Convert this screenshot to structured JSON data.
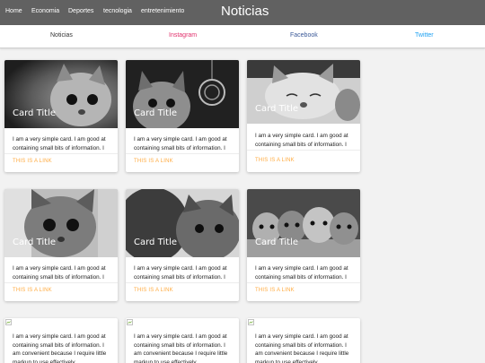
{
  "nav": {
    "brand": "Noticias",
    "links": [
      "Home",
      "Economia",
      "Deportes",
      "tecnologia",
      "entretenimiento"
    ]
  },
  "tabs": [
    {
      "label": "Noticias",
      "color": "#333333"
    },
    {
      "label": "Instagram",
      "color": "#e1306c"
    },
    {
      "label": "Facebook",
      "color": "#3b5998"
    },
    {
      "label": "Twitter",
      "color": "#1da1f2"
    }
  ],
  "image_cards": [
    {
      "title": "Card Title",
      "text": "I am a very simple card. I am good at containing small bits of information. I am convenient because I require little markup to use effectively.",
      "link": "THIS IS A LINK",
      "image": "kitten-photo"
    },
    {
      "title": "Card Title",
      "text": "I am a very simple card. I am good at containing small bits of information. I am convenient because I require little markup to use effectively.",
      "link": "THIS IS A LINK",
      "image": "kitten-with-ball-photo"
    },
    {
      "title": "Card Title",
      "text": "I am a very simple card. I am good at containing small bits of information. I am convenient because I require little markup to use effectively.",
      "link": "THIS IS A LINK",
      "image": "sleeping-kitten-photo"
    },
    {
      "title": "Card Title",
      "text": "I am a very simple card. I am good at containing small bits of information. I am convenient because I require little markup to use effectively.",
      "link": "THIS IS A LINK",
      "image": "kitten-photo"
    },
    {
      "title": "Card Title",
      "text": "I am a very simple card. I am good at containing small bits of information. I am convenient because I require little markup to use effectively.",
      "link": "THIS IS A LINK",
      "image": "kitten-closeup-photo"
    },
    {
      "title": "Card Title",
      "text": "I am a very simple card. I am good at containing small bits of information. I am convenient because I require little markup to use effectively.",
      "link": "THIS IS A LINK",
      "image": "kittens-group-photo"
    }
  ],
  "text_cards": [
    {
      "text": "I am a very simple card. I am good at containing small bits of information. I am convenient because I require little markup to use effectively.",
      "image": "broken-image-icon"
    },
    {
      "text": "I am a very simple card. I am good at containing small bits of information. I am convenient because I require little markup to use effectively.",
      "image": "broken-image-icon"
    },
    {
      "text": "I am a very simple card. I am good at containing small bits of information. I am convenient because I require little markup to use effectively.",
      "image": "broken-image-icon"
    }
  ],
  "colors": {
    "navbar": "#616161",
    "link": "#ffab40",
    "background": "#f2f2f2"
  }
}
